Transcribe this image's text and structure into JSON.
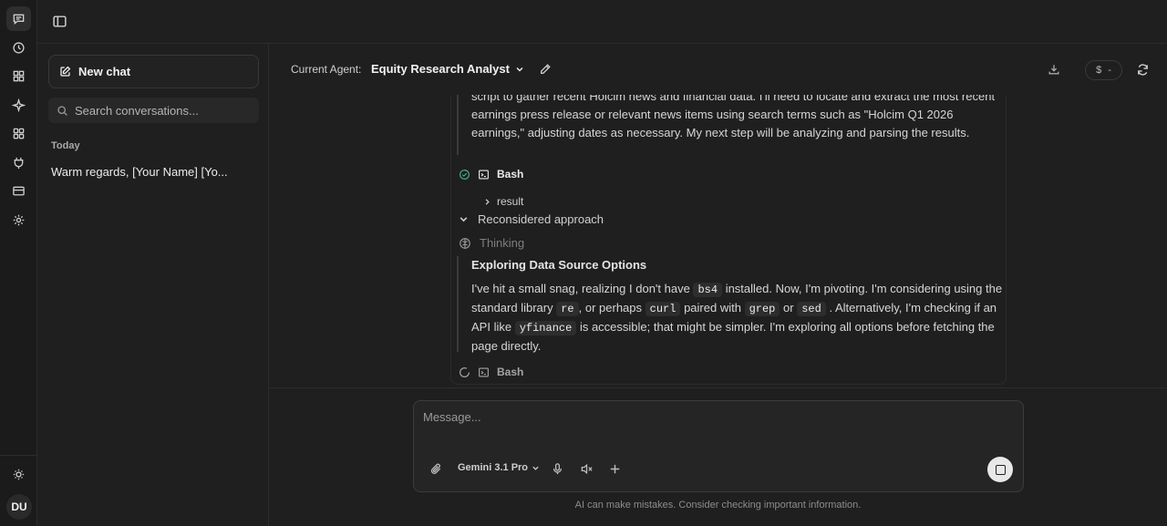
{
  "rail": {
    "items": [
      "chat-icon",
      "history-icon",
      "apps-icon",
      "sparkle-icon",
      "grid-icon",
      "plug-icon",
      "card-icon",
      "settings-icon"
    ],
    "avatar_initials": "DU"
  },
  "sidebar": {
    "new_chat_label": "New chat",
    "search_placeholder": "Search conversations...",
    "section_today": "Today",
    "conversations": [
      "Warm regards, [Your Name] [Yo..."
    ]
  },
  "header": {
    "agent_label": "Current Agent:",
    "agent_name": "Equity Research Analyst",
    "cost_symbol": "$",
    "cost_value": "-"
  },
  "chat": {
    "thought1_text": "script to gather recent Holcim news and financial data. I'll need to locate and extract the most recent earnings press release or relevant news items using search terms such as \"Holcim Q1 2026 earnings,\" adjusting dates as necessary. My next step will be analyzing and parsing the results.",
    "tool1_name": "Bash",
    "tool1_result_label": "result",
    "reconsidered_label": "Reconsidered approach",
    "thinking_label": "Thinking",
    "thought2_title": "Exploring Data Source Options",
    "thought2": {
      "p1": "I've hit a small snag, realizing I don't have",
      "c1": "bs4",
      "p2": "installed. Now, I'm pivoting. I'm considering using the standard library",
      "c2": "re",
      "p3": ", or perhaps",
      "c3": "curl",
      "p4": "paired with",
      "c4": "grep",
      "p5": "or",
      "c5": "sed",
      "p6": ". Alternatively, I'm checking if an API like",
      "c6": "yfinance",
      "p7": "is accessible; that might be simpler. I'm exploring all options before fetching the page directly."
    },
    "tool2_name": "Bash"
  },
  "composer": {
    "placeholder": "Message...",
    "model_name": "Gemini 3.1 Pro",
    "disclaimer": "AI can make mistakes. Consider checking important information."
  },
  "colors": {
    "background": "#1f1f1f",
    "success": "#3fb37f"
  }
}
